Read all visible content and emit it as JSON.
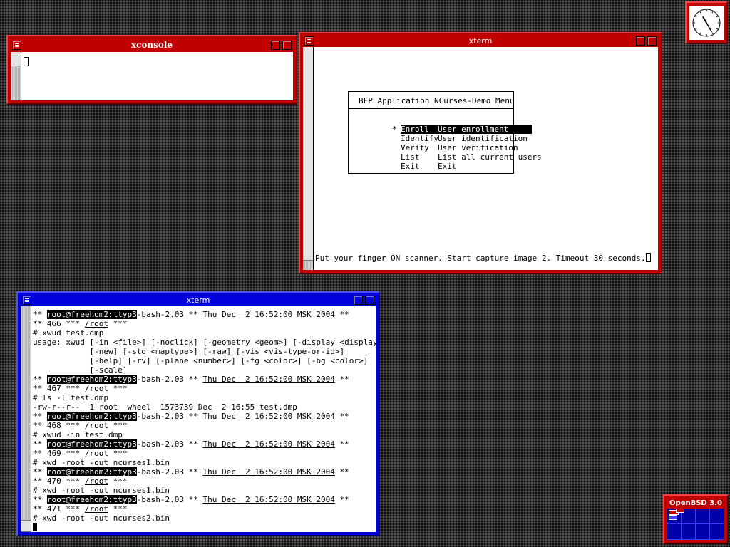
{
  "xconsole": {
    "title": "xconsole"
  },
  "xterm_top": {
    "title": "xterm",
    "menu_title": "BFP Application NCurses-Demo Menu",
    "menu_items": [
      {
        "marker": "*",
        "name": "Enroll",
        "desc": "User enrollment",
        "selected": true
      },
      {
        "marker": "",
        "name": "Identify",
        "desc": "User identification",
        "selected": false
      },
      {
        "marker": "",
        "name": "Verify",
        "desc": "User verification",
        "selected": false
      },
      {
        "marker": "",
        "name": "List",
        "desc": "List all current users",
        "selected": false
      },
      {
        "marker": "",
        "name": "Exit",
        "desc": "Exit",
        "selected": false
      }
    ],
    "status_line": "Put your finger ON scanner. Start capture image 2. Timeout 30 seconds."
  },
  "xterm_bottom": {
    "title": "xterm",
    "lines": [
      {
        "type": "header",
        "user": "root@freehom2:ttyp3",
        "shell": "-bash-2.03",
        "date": "Thu Dec  2 16:52:00 MSK 2004"
      },
      {
        "type": "cwd",
        "num": "466",
        "path": "/root"
      },
      {
        "type": "text",
        "text": "# xwud test.dmp"
      },
      {
        "type": "text",
        "text": "usage: xwud [-in <file>] [-noclick] [-geometry <geom>] [-display <display>]"
      },
      {
        "type": "text",
        "text": "            [-new] [-std <maptype>] [-raw] [-vis <vis-type-or-id>]"
      },
      {
        "type": "text",
        "text": "            [-help] [-rv] [-plane <number>] [-fg <color>] [-bg <color>]"
      },
      {
        "type": "text",
        "text": "            [-scale]"
      },
      {
        "type": "header",
        "user": "root@freehom2:ttyp3",
        "shell": "-bash-2.03",
        "date": "Thu Dec  2 16:52:00 MSK 2004"
      },
      {
        "type": "cwd",
        "num": "467",
        "path": "/root"
      },
      {
        "type": "text",
        "text": "# ls -l test.dmp"
      },
      {
        "type": "text",
        "text": "-rw-r--r--  1 root  wheel  1573739 Dec  2 16:55 test.dmp"
      },
      {
        "type": "header",
        "user": "root@freehom2:ttyp3",
        "shell": "-bash-2.03",
        "date": "Thu Dec  2 16:52:00 MSK 2004"
      },
      {
        "type": "cwd",
        "num": "468",
        "path": "/root"
      },
      {
        "type": "text",
        "text": "# xwud -in test.dmp"
      },
      {
        "type": "header",
        "user": "root@freehom2:ttyp3",
        "shell": "-bash-2.03",
        "date": "Thu Dec  2 16:52:00 MSK 2004"
      },
      {
        "type": "cwd",
        "num": "469",
        "path": "/root"
      },
      {
        "type": "text",
        "text": "# xwd -root -out ncurses1.bin"
      },
      {
        "type": "header",
        "user": "root@freehom2:ttyp3",
        "shell": "-bash-2.03",
        "date": "Thu Dec  2 16:52:00 MSK 2004"
      },
      {
        "type": "cwd",
        "num": "470",
        "path": "/root"
      },
      {
        "type": "text",
        "text": "# xwd -root -out ncurses1.bin"
      },
      {
        "type": "header",
        "user": "root@freehom2:ttyp3",
        "shell": "-bash-2.03",
        "date": "Thu Dec  2 16:52:00 MSK 2004"
      },
      {
        "type": "cwd",
        "num": "471",
        "path": "/root"
      },
      {
        "type": "text",
        "text": "# xwd -root -out ncurses2.bin"
      },
      {
        "type": "cursor"
      }
    ]
  },
  "pager": {
    "label": "OpenBSD 3.0"
  },
  "clock": {
    "hour_angle_deg": 330,
    "minute_angle_deg": 150
  },
  "colors": {
    "active_frame": "#0000dd",
    "inactive_frame": "#c00000",
    "pager_bg": "#0000a8"
  },
  "icons": [
    "window-menu-icon",
    "iconify-button-icon",
    "maximize-button-icon",
    "clock-icon"
  ]
}
